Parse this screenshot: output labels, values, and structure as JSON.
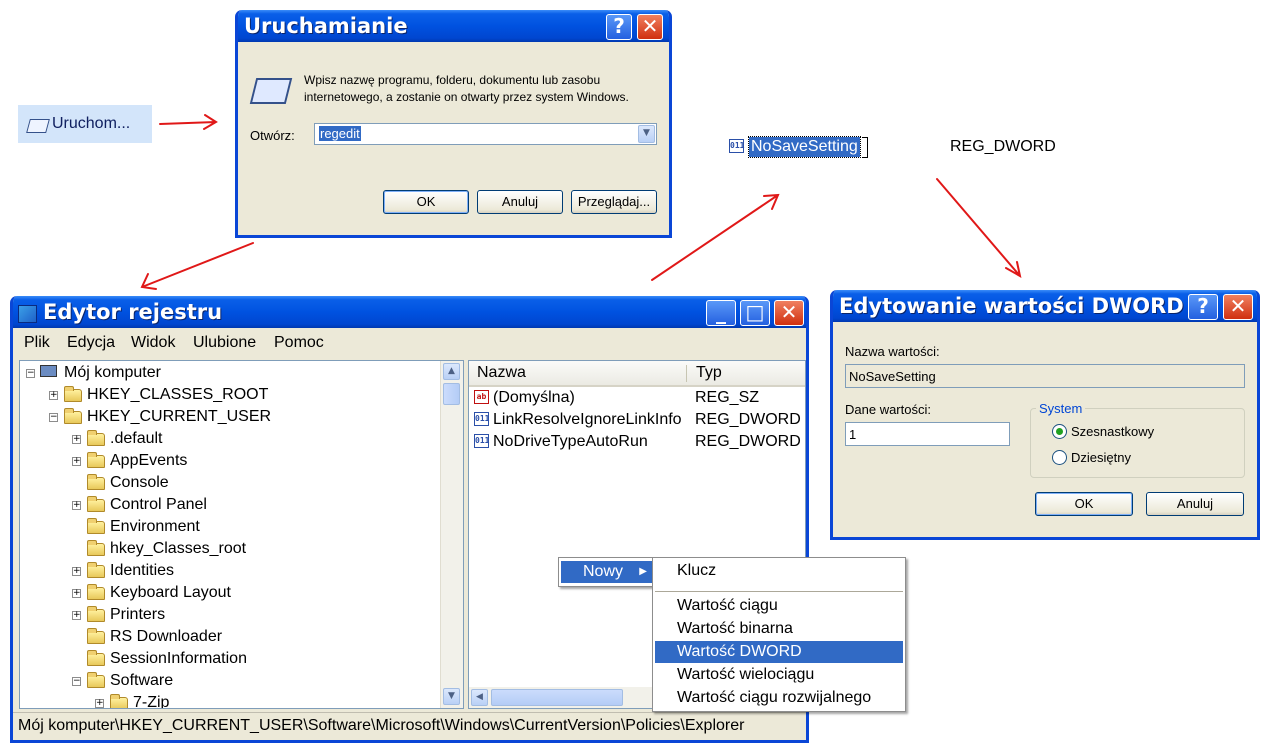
{
  "start_menu_item": {
    "label": "Uruchom..."
  },
  "run_dialog": {
    "title": "Uruchamianie",
    "help_glyph": "?",
    "close_glyph": "✕",
    "description": "Wpisz nazwę programu, folderu, dokumentu lub zasobu internetowego, a zostanie on otwarty przez system Windows.",
    "open_label": "Otwórz:",
    "open_value": "regedit",
    "ok": "OK",
    "cancel": "Anuluj",
    "browse": "Przeglądaj..."
  },
  "new_value_row": {
    "name": "NoSaveSetting",
    "type": "REG_DWORD"
  },
  "regedit": {
    "title": "Edytor rejestru",
    "minimize_glyph": "_",
    "maximize_glyph": "□",
    "close_glyph": "✕",
    "menu": [
      "Plik",
      "Edycja",
      "Widok",
      "Ulubione",
      "Pomoc"
    ],
    "tree": [
      {
        "label": "Mój komputer",
        "level": 0,
        "expander": "−",
        "icon": "computer"
      },
      {
        "label": "HKEY_CLASSES_ROOT",
        "level": 1,
        "expander": "+"
      },
      {
        "label": "HKEY_CURRENT_USER",
        "level": 1,
        "expander": "−"
      },
      {
        "label": ".default",
        "level": 2,
        "expander": "+"
      },
      {
        "label": "AppEvents",
        "level": 2,
        "expander": "+"
      },
      {
        "label": "Console",
        "level": 2,
        "expander": ""
      },
      {
        "label": "Control Panel",
        "level": 2,
        "expander": "+"
      },
      {
        "label": "Environment",
        "level": 2,
        "expander": ""
      },
      {
        "label": "hkey_Classes_root",
        "level": 2,
        "expander": ""
      },
      {
        "label": "Identities",
        "level": 2,
        "expander": "+"
      },
      {
        "label": "Keyboard Layout",
        "level": 2,
        "expander": "+"
      },
      {
        "label": "Printers",
        "level": 2,
        "expander": "+"
      },
      {
        "label": "RS Downloader",
        "level": 2,
        "expander": ""
      },
      {
        "label": "SessionInformation",
        "level": 2,
        "expander": ""
      },
      {
        "label": "Software",
        "level": 2,
        "expander": "−"
      },
      {
        "label": "7-Zip",
        "level": 3,
        "expander": "+"
      }
    ],
    "columns": {
      "name": "Nazwa",
      "type": "Typ"
    },
    "values": [
      {
        "name": "(Domyślna)",
        "type": "REG_SZ",
        "icon": "ab"
      },
      {
        "name": "LinkResolveIgnoreLinkInfo",
        "type": "REG_DWORD",
        "icon": "011"
      },
      {
        "name": "NoDriveTypeAutoRun",
        "type": "REG_DWORD",
        "icon": "011"
      }
    ],
    "status": "Mój komputer\\HKEY_CURRENT_USER\\Software\\Microsoft\\Windows\\CurrentVersion\\Policies\\Explorer"
  },
  "context_menu": {
    "parent": "Nowy",
    "submenu": [
      "Klucz",
      "Wartość ciągu",
      "Wartość binarna",
      "Wartość DWORD",
      "Wartość wielociągu",
      "Wartość ciągu rozwijalnego"
    ],
    "selected": "Wartość DWORD"
  },
  "dword_dialog": {
    "title": "Edytowanie wartości DWORD",
    "help_glyph": "?",
    "close_glyph": "✕",
    "name_label": "Nazwa wartości:",
    "name_value": "NoSaveSetting",
    "data_label": "Dane wartości:",
    "data_value": "1",
    "system_label": "System",
    "hex": "Szesnastkowy",
    "dec": "Dziesiętny",
    "ok": "OK",
    "cancel": "Anuluj"
  },
  "colors": {
    "xp_blue": "#0a46d6",
    "selection": "#316ac5",
    "arrow": "#e01818",
    "face": "#ece9d8"
  }
}
